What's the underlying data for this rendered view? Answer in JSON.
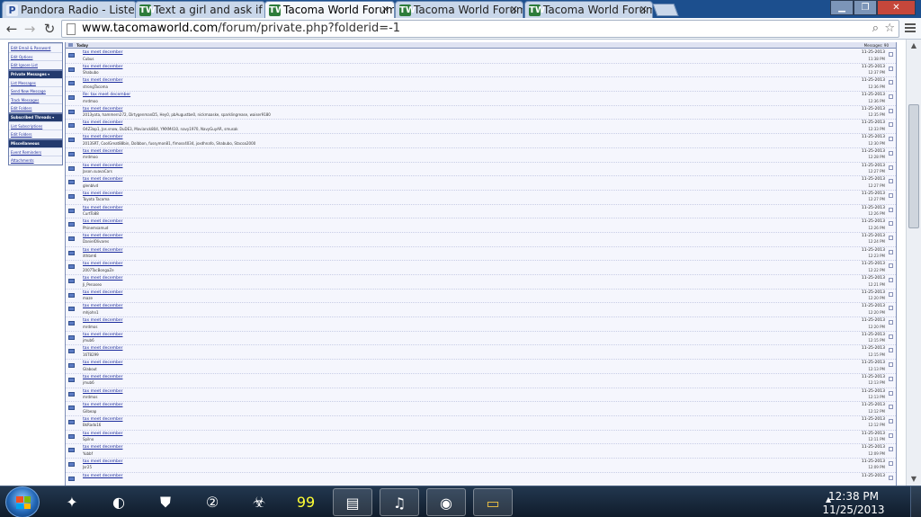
{
  "browser": {
    "tabs": [
      {
        "label": "Pandora Radio - Listen",
        "favicon": "pandora-icon",
        "active": false
      },
      {
        "label": "Text a girl and ask if",
        "favicon": "tacoma-world-icon",
        "active": false
      },
      {
        "label": "Tacoma World Forum",
        "favicon": "tacoma-world-icon",
        "active": true
      },
      {
        "label": "Tacoma World Forum",
        "favicon": "tacoma-world-icon",
        "active": false
      },
      {
        "label": "Tacoma World Forum",
        "favicon": "tacoma-world-icon",
        "active": false
      }
    ],
    "url_host": "www.tacomaworld.com",
    "url_path": "/forum/private.php?folderid=-1"
  },
  "sidebar": {
    "blocks": [
      {
        "head": "",
        "items": [
          "Edit Email & Password",
          "Edit Options",
          "Edit Ignore List"
        ]
      },
      {
        "head": "Private Messages",
        "items": [
          "List Messages",
          "Send New Message",
          "Track Messages",
          "Edit Folders"
        ]
      },
      {
        "head": "Subscribed Threads",
        "items": [
          "List Subscriptions",
          "Edit Folders"
        ]
      },
      {
        "head": "Miscellaneous",
        "items": [
          "Event Reminders",
          "Attachments"
        ]
      }
    ]
  },
  "list": {
    "header_left": "Today",
    "header_right": "Messages: 90",
    "rows": [
      {
        "subject": "tax meet december",
        "from": "Cubus",
        "date": "11-25-2013",
        "time": "11:38 PM"
      },
      {
        "subject": "tax meet december",
        "from": "Shabubo",
        "date": "11-25-2013",
        "time": "12:37 PM"
      },
      {
        "subject": "tax meet december",
        "from": "strongTacoma",
        "date": "11-25-2013",
        "time": "12:36 PM"
      },
      {
        "subject": "Re: tax meet december",
        "from": "mrdmoo",
        "date": "11-25-2013",
        "time": "12:36 PM"
      },
      {
        "subject": "tax meet december",
        "from": "2013yota, hammern272, DirtygenmanD5, Hey0, pbAugustbe0, nickmaaske, sparklingrease, waiser9180",
        "date": "11-25-2013",
        "time": "12:35 PM"
      },
      {
        "subject": "tax meet december",
        "from": "O4Z3ap1, Jos.snow, DuDE3, Mavianck804, YMXM410, navy1970, NavyGuyAR, smusak",
        "date": "11-25-2013",
        "time": "12:33 PM"
      },
      {
        "subject": "tax meet december",
        "from": "2013SRT, CoolGreat88bin, Dolbbon, fussymon81, fimoss4034, joxdhnafo, Shabubo, Stacoa2000",
        "date": "11-25-2013",
        "time": "12:30 PM"
      },
      {
        "subject": "tax meet december",
        "from": "mrdmoo",
        "date": "11-25-2013",
        "time": "12:28 PM"
      },
      {
        "subject": "tax meet december",
        "from": "Jason.suavaCars",
        "date": "11-25-2013",
        "time": "12:27 PM"
      },
      {
        "subject": "tax meet december",
        "from": "glenblvd",
        "date": "11-25-2013",
        "time": "12:27 PM"
      },
      {
        "subject": "tax meet december",
        "from": "Toyota Tacoma",
        "date": "11-25-2013",
        "time": "12:27 PM"
      },
      {
        "subject": "tax meet december",
        "from": "CurtTo88",
        "date": "11-25-2013",
        "time": "12:26 PM"
      },
      {
        "subject": "tax meet december",
        "from": "Phinemsamud",
        "date": "11-25-2013",
        "time": "12:26 PM"
      },
      {
        "subject": "tax meet december",
        "from": "DanielOlivares",
        "date": "11-25-2013",
        "time": "12:24 PM"
      },
      {
        "subject": "tax meet december",
        "from": "ilthbm6",
        "date": "11-25-2013",
        "time": "12:23 PM"
      },
      {
        "subject": "tax meet december",
        "from": "2007TacBongaZe",
        "date": "11-25-2013",
        "time": "12:22 PM"
      },
      {
        "subject": "tax meet december",
        "from": "Ji_Penaseo",
        "date": "11-25-2013",
        "time": "12:21 PM"
      },
      {
        "subject": "tax meet december",
        "from": "maze",
        "date": "11-25-2013",
        "time": "12:20 PM"
      },
      {
        "subject": "tax meet december",
        "from": "mhjohn1",
        "date": "11-25-2013",
        "time": "12:20 PM"
      },
      {
        "subject": "tax meet december",
        "from": "mrdmos",
        "date": "11-25-2013",
        "time": "12:20 PM"
      },
      {
        "subject": "tax meet december",
        "from": "jmub6",
        "date": "11-25-2013",
        "time": "12:15 PM"
      },
      {
        "subject": "tax meet december",
        "from": "16T8299",
        "date": "11-25-2013",
        "time": "12:15 PM"
      },
      {
        "subject": "tax meet december",
        "from": "Glabout",
        "date": "11-25-2013",
        "time": "12:13 PM"
      },
      {
        "subject": "tax meet december",
        "from": "jmub6",
        "date": "11-25-2013",
        "time": "12:13 PM"
      },
      {
        "subject": "tax meet december",
        "from": "mrdmos",
        "date": "11-25-2013",
        "time": "12:13 PM"
      },
      {
        "subject": "tax meet december",
        "from": "Gilbeap",
        "date": "11-25-2013",
        "time": "12:12 PM"
      },
      {
        "subject": "tax meet december",
        "from": "BkRado16",
        "date": "11-25-2013",
        "time": "12:12 PM"
      },
      {
        "subject": "tax meet december",
        "from": "Spilno",
        "date": "11-25-2013",
        "time": "12:11 PM"
      },
      {
        "subject": "tax meet december",
        "from": "Yubbf",
        "date": "11-25-2013",
        "time": "12:09 PM"
      },
      {
        "subject": "tax meet december",
        "from": "Jsr25",
        "date": "11-25-2013",
        "time": "12:09 PM"
      },
      {
        "subject": "tax meet december",
        "from": "",
        "date": "11-25-2013",
        "time": ""
      }
    ]
  },
  "taskbar": {
    "apps": [
      "start-orb",
      "starcraft-icon",
      "ventrilo-icon",
      "shield-helmet-icon",
      "two-icon",
      "monster-icon",
      "99-icon",
      "notepad-icon",
      "itunes-icon",
      "chrome-icon",
      "folder-icon"
    ],
    "time": "12:38 PM",
    "date": "11/25/2013"
  }
}
